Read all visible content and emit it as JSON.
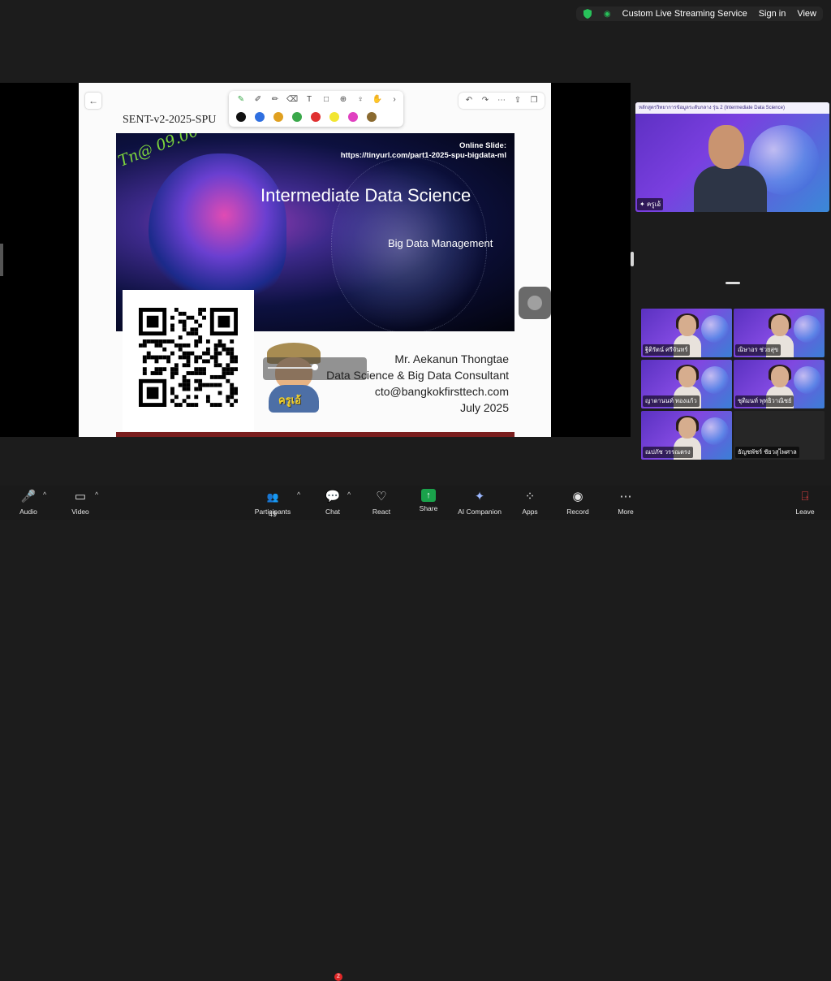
{
  "topbar": {
    "service": "Custom Live Streaming Service",
    "sign_in": "Sign in",
    "view": "View"
  },
  "slide": {
    "file_title": "SENT-v2-2025-SPU",
    "online_label": "Online Slide:",
    "online_url": "https://tinyurl.com/part1-2025-spu-bigdata-ml",
    "title": "Intermediate Data Science",
    "subtitle": "Big Data Management",
    "scribble": "Tn@ 09.00",
    "avatar_tag": "ครูเอ้",
    "presenter": "Mr. Aekanun Thongtae",
    "role": "Data Science & Big Data Consultant",
    "email": "cto@bangkokfirsttech.com",
    "date": "July 2025"
  },
  "annotation_tools": {
    "colors": [
      "#111111",
      "#2f6fe0",
      "#e0a020",
      "#3aa84a",
      "#e03030",
      "#f2e630",
      "#e040c0",
      "#8a6a30"
    ]
  },
  "speaker": {
    "header": "หลักสูตรวิทยาการข้อมูลระดับกลาง รุ่น 2 (Intermediate Data Science)",
    "name": "ครูเอ้"
  },
  "gallery": [
    {
      "name": "ฐิติรัตน์ ศรีจันทร์"
    },
    {
      "name": "ณิษาอร ช่วยสุข"
    },
    {
      "name": "ญาดานนท์ ทองแก้ว"
    },
    {
      "name": "ชุติมนท์ พุทธิวาณิชย์"
    },
    {
      "name": "ณปภัช วรรณตรง"
    },
    {
      "name": "ธัญชพัชร์ ชัยวสุไพศาล"
    }
  ],
  "bottombar": {
    "audio": "Audio",
    "video": "Video",
    "participants": "Participants",
    "participant_count": "49",
    "chat": "Chat",
    "chat_badge": "2",
    "react": "React",
    "share": "Share",
    "ai": "AI Companion",
    "apps": "Apps",
    "record": "Record",
    "more": "More",
    "leave": "Leave"
  }
}
